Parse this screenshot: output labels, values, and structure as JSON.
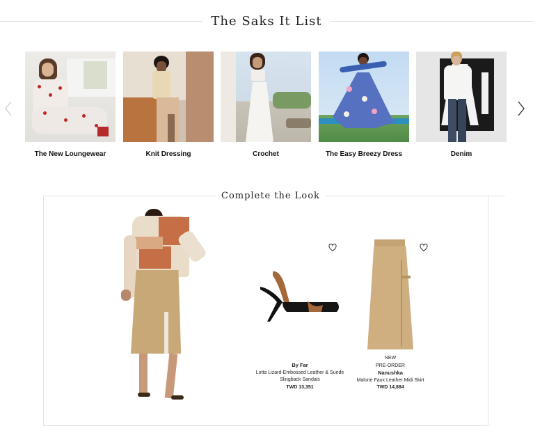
{
  "it_list": {
    "title": "The Saks It List",
    "items": [
      {
        "label": "The New Loungewear"
      },
      {
        "label": "Knit Dressing"
      },
      {
        "label": "Crochet"
      },
      {
        "label": "The Easy Breezy Dress"
      },
      {
        "label": "Denim"
      }
    ]
  },
  "complete_the_look": {
    "title": "Complete the Look",
    "products": [
      {
        "status": "",
        "preorder": "",
        "brand": "By Far",
        "name_line1": "Lotta Lizard-Embossed Leather & Suede",
        "name_line2": "Slingback Sandals",
        "price": "TWD 13,351"
      },
      {
        "status": "NEW",
        "preorder": "PRE-ORDER",
        "brand": "Nanushka",
        "name_line1": "Malorie Faux Leather Midi Skirt",
        "name_line2": "",
        "price": "TWD 14,884"
      }
    ]
  },
  "icons": [
    "chevron-left-icon",
    "chevron-right-icon",
    "heart-icon"
  ],
  "colors": {
    "accent_tan": "#c9a878",
    "divider": "#d6d6d6"
  }
}
